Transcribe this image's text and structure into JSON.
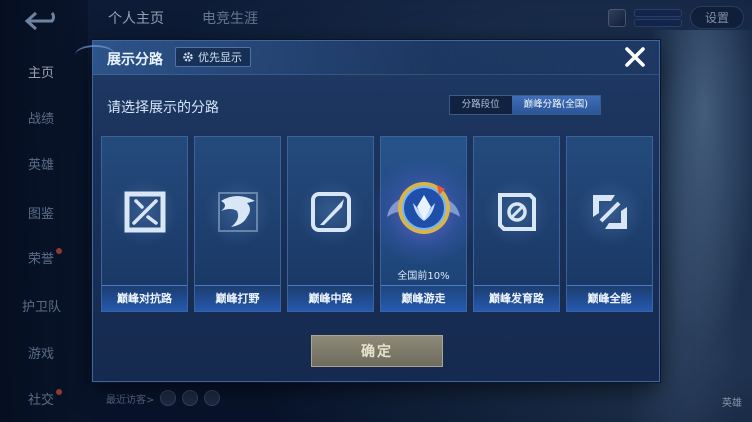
{
  "background": {
    "top_tabs": [
      "个人主页",
      "电竞生涯"
    ],
    "nav_items": [
      {
        "label": "主页",
        "active": true
      },
      {
        "label": "战绩",
        "active": false
      },
      {
        "label": "英雄",
        "active": false
      },
      {
        "label": "图鉴",
        "active": false
      },
      {
        "label": "荣誉",
        "active": false
      },
      {
        "label": "护卫队",
        "active": false
      },
      {
        "label": "游戏",
        "active": false
      },
      {
        "label": "社交",
        "active": false
      }
    ],
    "settings_label": "设置",
    "recent_visitors_label": "最近访客>",
    "bottom_right_label": "英雄"
  },
  "modal": {
    "title": "展示分路",
    "priority_label": "优先显示",
    "prompt": "请选择展示的分路",
    "seg_tabs": [
      {
        "label": "分路段位",
        "active": false
      },
      {
        "label": "巅峰分路(全国)",
        "active": true
      }
    ],
    "cards": [
      {
        "label": "巅峰对抗路",
        "icon": "crossed-swords-icon",
        "note": ""
      },
      {
        "label": "巅峰打野",
        "icon": "dragon-claw-icon",
        "note": ""
      },
      {
        "label": "巅峰中路",
        "icon": "diagonal-blade-icon",
        "note": ""
      },
      {
        "label": "巅峰游走",
        "icon": "winged-shield-icon",
        "note": "全国前10%",
        "featured": true
      },
      {
        "label": "巅峰发育路",
        "icon": "arrow-target-icon",
        "note": ""
      },
      {
        "label": "巅峰全能",
        "icon": "interlocked-squares-icon",
        "note": ""
      }
    ],
    "confirm_label": "确定"
  }
}
